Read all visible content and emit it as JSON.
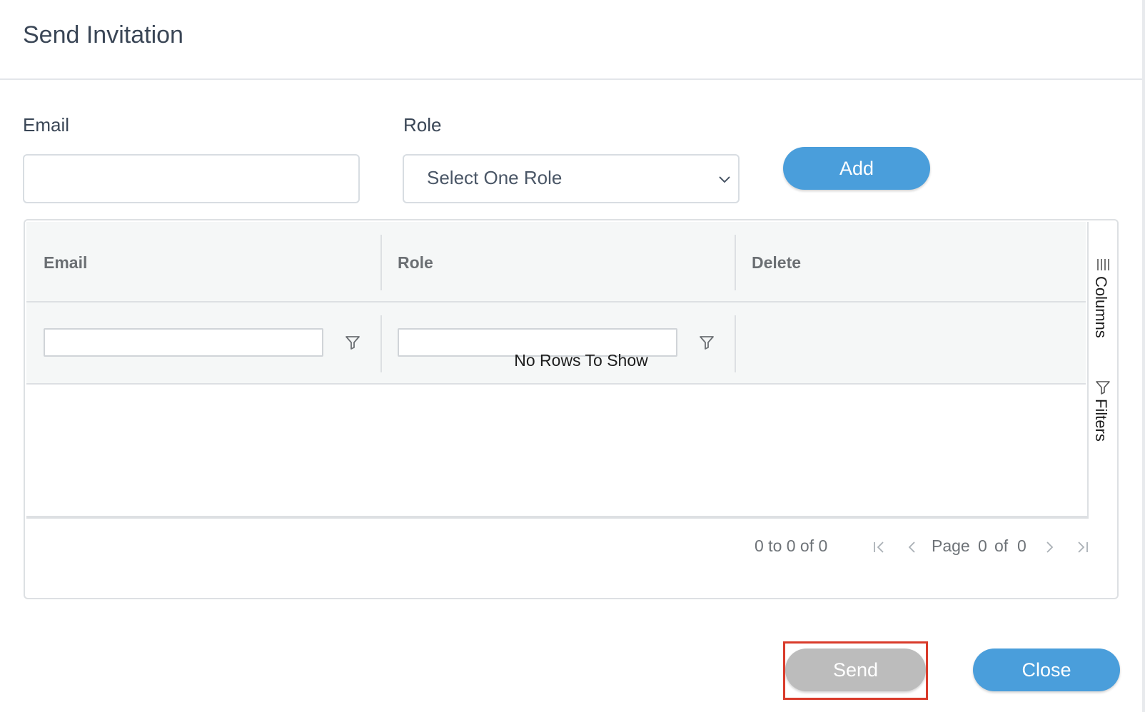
{
  "dialog": {
    "title": "Send Invitation"
  },
  "form": {
    "email_label": "Email",
    "email_value": "",
    "email_placeholder": "",
    "role_label": "Role",
    "role_selected": "Select One Role",
    "add_label": "Add"
  },
  "grid": {
    "columns": [
      "Email",
      "Role",
      "Delete"
    ],
    "no_rows_text": "No Rows To Show",
    "side_tabs": {
      "columns_label": "Columns",
      "filters_label": "Filters"
    },
    "paging": {
      "summary": "0 to 0 of 0",
      "page_word": "Page",
      "current_page": "0",
      "of_word": "of",
      "total_pages": "0"
    }
  },
  "footer": {
    "send_label": "Send",
    "close_label": "Close"
  },
  "colors": {
    "primary_button": "#4a9edb",
    "disabled_button": "#bcbcbc",
    "highlight_outline": "#d93b2b",
    "grid_header_bg": "#f5f7f7"
  },
  "icons": {
    "select_arrow": "chevron-down-icon",
    "filter": "filter-icon",
    "columns": "columns-icon",
    "first_page": "first-page-icon",
    "previous_page": "previous-page-icon",
    "next_page": "next-page-icon",
    "last_page": "last-page-icon"
  }
}
